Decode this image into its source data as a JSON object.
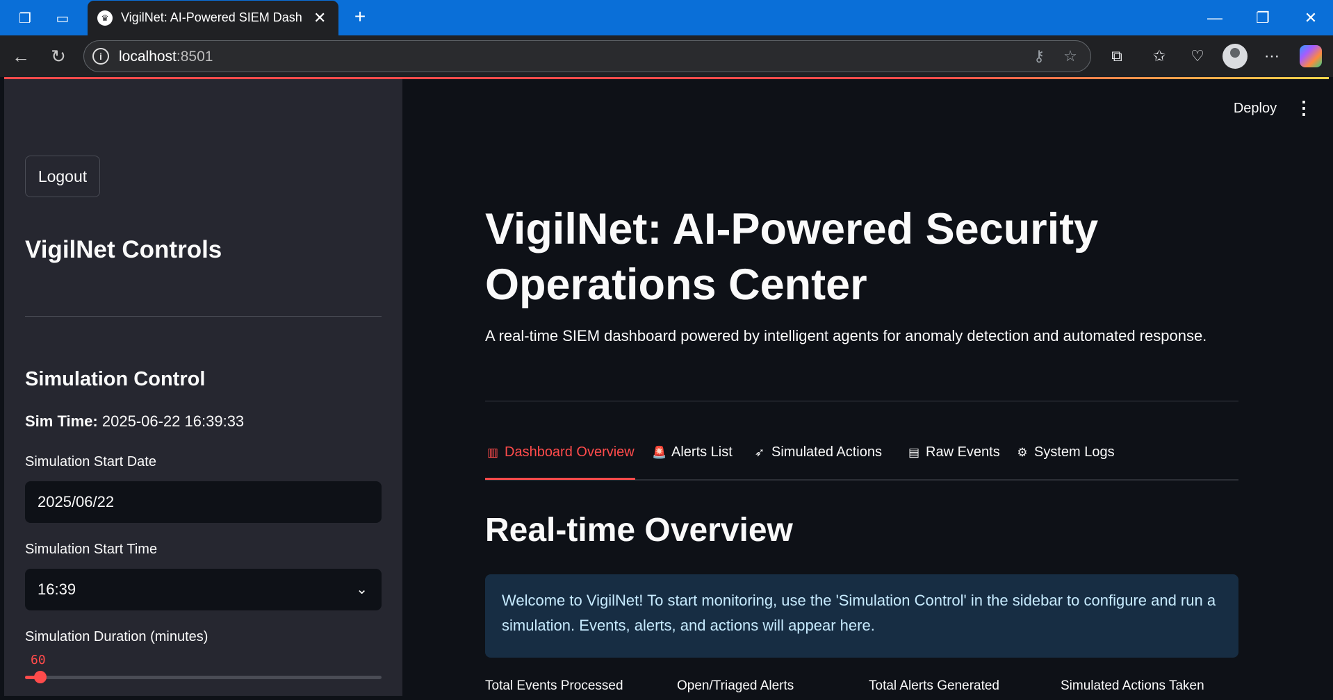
{
  "browser": {
    "tab_title": "VigilNet: AI-Powered SIEM Dashb",
    "url_host": "localhost",
    "url_port": ":8501"
  },
  "app": {
    "header": {
      "deploy_label": "Deploy"
    },
    "sidebar": {
      "logout_label": "Logout",
      "title": "VigilNet Controls",
      "section_title": "Simulation Control",
      "sim_time_label": "Sim Time:",
      "sim_time_value": "2025-06-22 16:39:33",
      "start_date_label": "Simulation Start Date",
      "start_date_value": "2025/06/22",
      "start_time_label": "Simulation Start Time",
      "start_time_value": "16:39",
      "duration_label": "Simulation Duration (minutes)",
      "duration_value": "60",
      "duration_fraction": 0.03
    },
    "main": {
      "title": "VigilNet: AI-Powered Security Operations Center",
      "subtitle": "A real-time SIEM dashboard powered by intelligent agents for anomaly detection and automated response.",
      "tabs": [
        {
          "label": "Dashboard Overview",
          "icon": "bar-chart-icon",
          "active": true
        },
        {
          "label": "Alerts List",
          "icon": "siren-icon"
        },
        {
          "label": "Simulated Actions",
          "icon": "rocket-icon"
        },
        {
          "label": "Raw Events",
          "icon": "scroll-icon"
        },
        {
          "label": "System Logs",
          "icon": "gear-icon"
        }
      ],
      "section_title": "Real-time Overview",
      "info_message": "Welcome to VigilNet! To start monitoring, use the 'Simulation Control' in the sidebar to configure and run a simulation. Events, alerts, and actions will appear here.",
      "metrics": [
        {
          "label": "Total Events Processed"
        },
        {
          "label": "Open/Triaged Alerts"
        },
        {
          "label": "Total Alerts Generated"
        },
        {
          "label": "Simulated Actions Taken"
        }
      ]
    }
  },
  "colors": {
    "accent": "#ff4b4b",
    "browser_tabbar": "#0a6fd8",
    "sidebar_bg": "#262730",
    "main_bg": "#0e1117",
    "info_bg": "#172d43"
  }
}
